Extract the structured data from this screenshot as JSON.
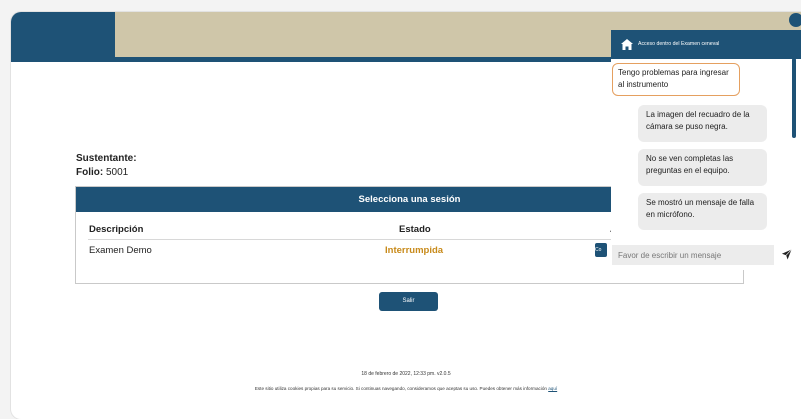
{
  "candidate": {
    "sustentante_label": "Sustentante:",
    "folio_label": "Folio:",
    "folio_value": "5001"
  },
  "sessions": {
    "title": "Selecciona una sesión",
    "columns": [
      "Descripción",
      "Estado",
      "A"
    ],
    "rows": [
      {
        "descripcion": "Examen Demo",
        "estado": "Interrumpida",
        "action_label": "Co"
      }
    ]
  },
  "actions": {
    "salir_label": "Salir"
  },
  "footer": {
    "date": "18 de febrero de 2022, 12:33 pm. v2.0.5",
    "cookies_text": "Este sitio utiliza cookies propias para su servicio. Si continuas navegando, consideramos que aceptas su uso. Puedes obtener más información",
    "cookies_link": "aquí"
  },
  "chat": {
    "header": "Acceso dentro del Examen ceneval",
    "selected_option": "Tengo problemas para ingresar al instrumento",
    "options": [
      "La imagen del recuadro de la cámara se puso negra.",
      "No se ven completas las preguntas en el equipo.",
      "Se mostró un mensaje de falla en micrófono."
    ],
    "input_placeholder": "Favor de escribir un mensaje"
  },
  "icons": {
    "header": "home-icon",
    "send": "send-icon"
  },
  "colors": {
    "primary": "#1e5276",
    "header_tan": "#cfc6a9",
    "status_interrumpida": "#c88a1a",
    "selected_border": "#e5a060"
  }
}
